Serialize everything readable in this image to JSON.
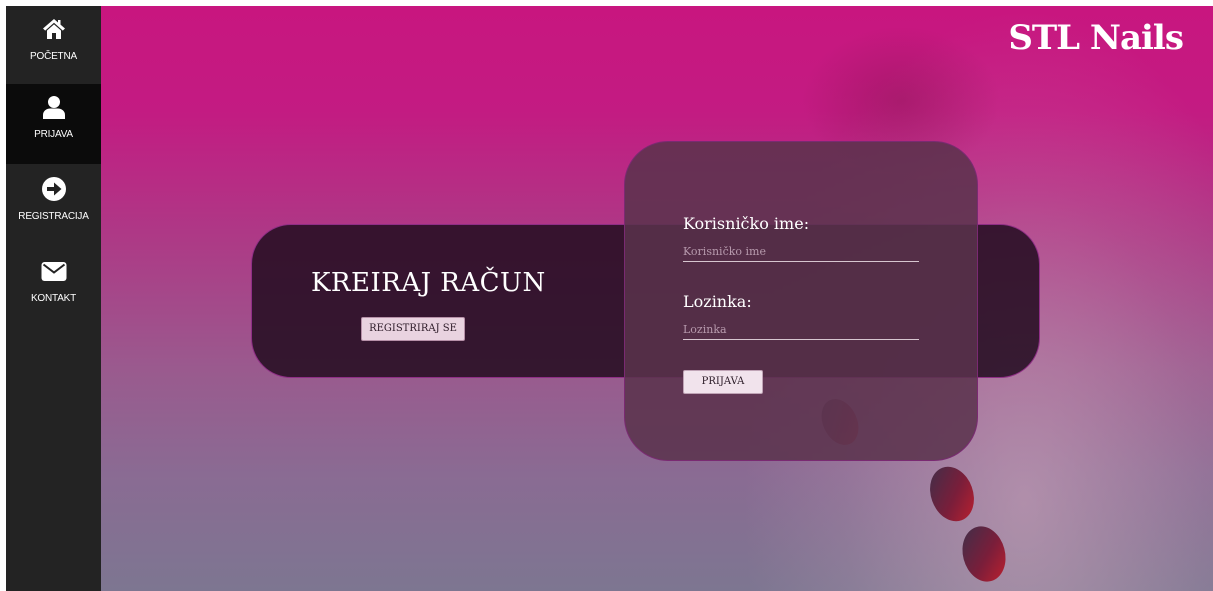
{
  "sidebar": {
    "items": [
      {
        "label": "POČETNA",
        "icon": "home-icon",
        "active": false
      },
      {
        "label": "PRIJAVA",
        "icon": "user-icon",
        "active": true
      },
      {
        "label": "REGISTRACIJA",
        "icon": "arrow-right-circle-icon",
        "active": false
      },
      {
        "label": "KONTAKT",
        "icon": "envelope-icon",
        "active": false
      }
    ]
  },
  "brand": {
    "name": "STL Nails"
  },
  "create_account": {
    "title": "KREIRAJ RAČUN",
    "button_label": "REGISTRIRAJ SE"
  },
  "login": {
    "username_label": "Korisničko ime:",
    "username_placeholder": "Korisničko ime",
    "username_value": "",
    "password_label": "Lozinka:",
    "password_placeholder": "Lozinka",
    "password_value": "",
    "button_label": "PRIJAVA"
  },
  "colors": {
    "accent_magenta": "#c8167f",
    "sidebar_bg": "#232323",
    "sidebar_active_bg": "#0b0b0b"
  }
}
